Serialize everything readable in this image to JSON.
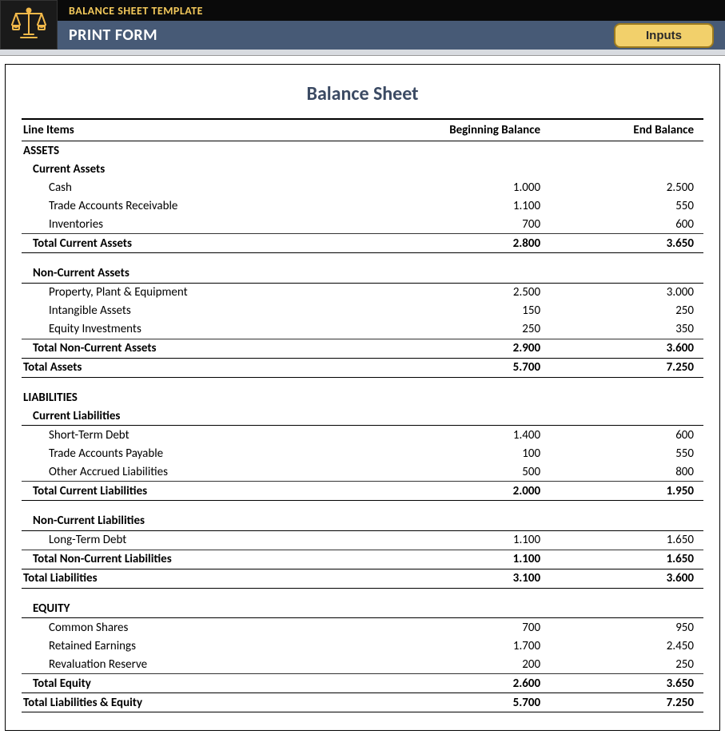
{
  "header": {
    "template_label": "BALANCE SHEET TEMPLATE",
    "print_form": "PRINT FORM",
    "inputs_btn": "Inputs"
  },
  "sheet": {
    "title": "Balance Sheet",
    "col_items": "Line Items",
    "col_begin": "Beginning Balance",
    "col_end": "End Balance"
  },
  "assets": {
    "heading": "ASSETS",
    "current_heading": "Current Assets",
    "cash": {
      "label": "Cash",
      "begin": "1.000",
      "end": "2.500"
    },
    "tar": {
      "label": "Trade Accounts Receivable",
      "begin": "1.100",
      "end": "550"
    },
    "inv": {
      "label": "Inventories",
      "begin": "700",
      "end": "600"
    },
    "total_current": {
      "label": "Total Current Assets",
      "begin": "2.800",
      "end": "3.650"
    },
    "noncurrent_heading": "Non-Current Assets",
    "ppe": {
      "label": "Property, Plant & Equipment",
      "begin": "2.500",
      "end": "3.000"
    },
    "intan": {
      "label": "Intangible Assets",
      "begin": "150",
      "end": "250"
    },
    "eqinv": {
      "label": "Equity Investments",
      "begin": "250",
      "end": "350"
    },
    "total_noncurrent": {
      "label": "Total Non-Current Assets",
      "begin": "2.900",
      "end": "3.600"
    },
    "total": {
      "label": "Total Assets",
      "begin": "5.700",
      "end": "7.250"
    }
  },
  "liab": {
    "heading": "LIABILITIES",
    "current_heading": "Current Liabilities",
    "std": {
      "label": "Short-Term Debt",
      "begin": "1.400",
      "end": "600"
    },
    "tap": {
      "label": "Trade Accounts Payable",
      "begin": "100",
      "end": "550"
    },
    "oal": {
      "label": "Other Accrued Liabilities",
      "begin": "500",
      "end": "800"
    },
    "total_current": {
      "label": "Total Current Liabilities",
      "begin": "2.000",
      "end": "1.950"
    },
    "noncurrent_heading": "Non-Current Liabilities",
    "ltd": {
      "label": "Long-Term Debt",
      "begin": "1.100",
      "end": "1.650"
    },
    "total_noncurrent": {
      "label": "Total Non-Current Liabilities",
      "begin": "1.100",
      "end": "1.650"
    },
    "total": {
      "label": "Total Liabilities",
      "begin": "3.100",
      "end": "3.600"
    }
  },
  "equity": {
    "heading": "EQUITY",
    "cs": {
      "label": "Common Shares",
      "begin": "700",
      "end": "950"
    },
    "re": {
      "label": "Retained Earnings",
      "begin": "1.700",
      "end": "2.450"
    },
    "rr": {
      "label": "Revaluation Reserve",
      "begin": "200",
      "end": "250"
    },
    "total": {
      "label": "Total Equity",
      "begin": "2.600",
      "end": "3.650"
    },
    "total_le": {
      "label": "Total Liabilities & Equity",
      "begin": "5.700",
      "end": "7.250"
    }
  }
}
